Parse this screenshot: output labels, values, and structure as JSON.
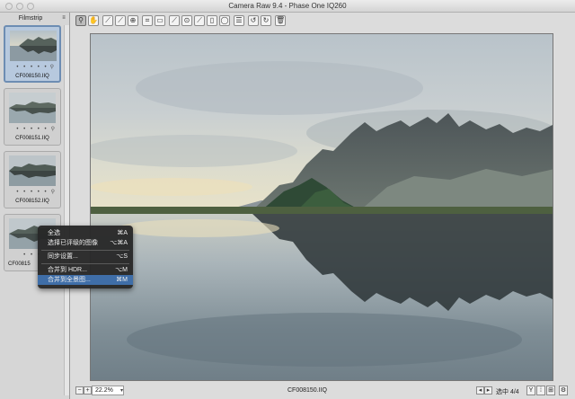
{
  "window": {
    "title": "Camera Raw 9.4 -  Phase One IQ260"
  },
  "filmstrip": {
    "title": "Filmstrip",
    "menu_icon": "panel-menu-icon",
    "items": [
      {
        "filename": "CF008150.IIQ",
        "rating_dots": "• • • • •",
        "selected": true
      },
      {
        "filename": "CF008151.IIQ",
        "rating_dots": "• • • • •",
        "selected": false
      },
      {
        "filename": "CF008152.IIQ",
        "rating_dots": "• • • • •",
        "selected": false
      },
      {
        "filename": "CF00815",
        "rating_dots": "• • •",
        "selected": false
      }
    ]
  },
  "toolbar": {
    "tools": [
      "zoom-tool-icon",
      "hand-tool-icon",
      "white-balance-icon",
      "color-sampler-icon",
      "targeted-adjustment-icon",
      "crop-icon",
      "straighten-icon",
      "spot-removal-icon",
      "red-eye-icon",
      "adjustment-brush-icon",
      "graduated-filter-icon",
      "radial-filter-icon",
      "preferences-list-icon",
      "rotate-ccw-icon",
      "rotate-cw-icon",
      "trash-icon"
    ]
  },
  "context_menu": {
    "items": [
      {
        "label": "全选",
        "shortcut": "⌘A"
      },
      {
        "label": "选择已评级的图像",
        "shortcut": "⌥⌘A"
      },
      {
        "label": "同步设置...",
        "shortcut": "⌥S"
      },
      {
        "label": "合并到 HDR...",
        "shortcut": "⌥M"
      },
      {
        "label": "合并到全景图...",
        "shortcut": "⌘M",
        "highlighted": true
      }
    ]
  },
  "bottombar": {
    "zoom_value": "22.2%",
    "filename": "CF008150.IIQ",
    "selection_count": "选中 4/4",
    "view_buttons": [
      "Y",
      "⁞",
      "⊞"
    ]
  },
  "colors": {
    "selection": "#b7c9de",
    "menu_highlight": "#3f6ea8",
    "menu_bg": "#282828"
  }
}
